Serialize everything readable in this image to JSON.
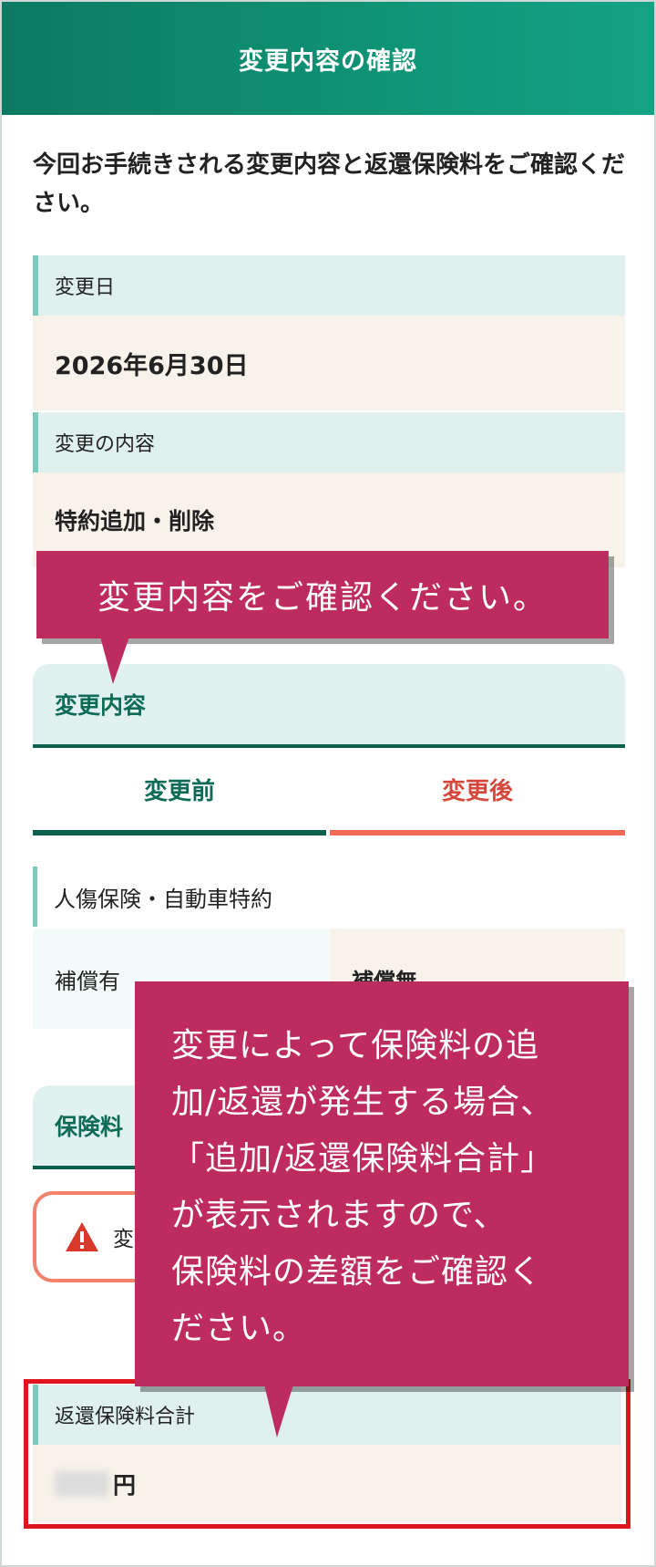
{
  "header": {
    "title": "変更内容の確認"
  },
  "intro": {
    "text": "今回お手続きされる変更内容と返還保険料をご確認ください。"
  },
  "change_date": {
    "label": "変更日",
    "value": "2026年6月30日"
  },
  "change_content": {
    "label": "変更の内容",
    "value": "特約追加・削除"
  },
  "details": {
    "section_title": "変更内容",
    "tab_before": "変更前",
    "tab_after": "変更後",
    "item_label": "人傷保険・自動車特約",
    "before_value": "補償有",
    "after_value": "補償無"
  },
  "premium": {
    "section_title": "保険料",
    "warning_text": "変",
    "refund_label": "返還保険料合計",
    "refund_unit": "円"
  },
  "callouts": {
    "first": "変更内容をご確認ください。",
    "second_lines": [
      "変更によって保険料の追",
      "加/返還が発生する場合、",
      "「追加/返還保険料合計」",
      "が表示されますので、",
      "保険料の差額をご確認く",
      "ださい。"
    ]
  },
  "colors": {
    "accent_green": "#0f9476",
    "callout": "#be2b5f",
    "after_red": "#d5473b"
  }
}
